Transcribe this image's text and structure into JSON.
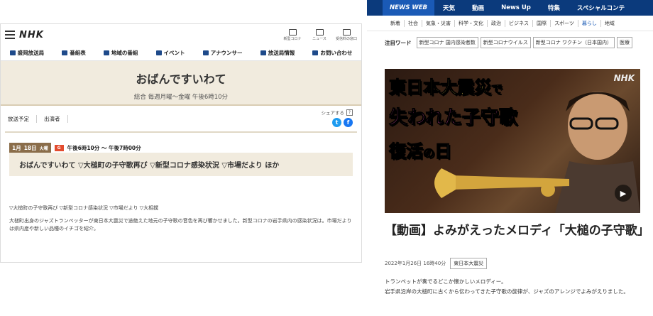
{
  "left": {
    "logo": "NHK",
    "top_icons": [
      {
        "label": "新型コロナ",
        "icon": "corona-icon"
      },
      {
        "label": "ニュース",
        "icon": "news-icon"
      },
      {
        "label": "受信料の窓口",
        "icon": "tv-icon"
      }
    ],
    "nav": [
      "盛岡放送局",
      "番組表",
      "地域の番組",
      "イベント",
      "アナウンサー",
      "放送局情報",
      "お問い合わせ"
    ],
    "program_title": "おばんですいわて",
    "schedule": "総合 毎週月曜～金曜 午後6時10分",
    "tabs": [
      "放送予定",
      "出演者"
    ],
    "share_label": "シェアする",
    "share_help": "?",
    "episode": {
      "month": "1月",
      "day": "18日",
      "weekday": "火曜",
      "channel": "G",
      "time": "午後6時10分 ～ 午後7時00分",
      "title": "おばんですいわて ▽大槌町の子守歌再び ▽新型コロナ感染状況 ▽市場だより ほか",
      "tags": "▽大槌町の子守歌再び ▽新型コロナ感染状況 ▽市場だより ▽大相撲",
      "description": "大槌町出身のジャズトランペッターが東日本大震災で途絶えた地元の子守歌の音色を再び響かせました。新型コロナの岩手県内の感染状況は。市場だよりは県内産や新しい品種のイチゴを紹介。"
    }
  },
  "right": {
    "nav": [
      "NEWS WEB",
      "天気",
      "動画",
      "News Up",
      "特集",
      "スペシャルコンテ"
    ],
    "categories": [
      "新着",
      "社会",
      "気象・災害",
      "科学・文化",
      "政治",
      "ビジネス",
      "国際",
      "スポーツ",
      "暮らし",
      "地域"
    ],
    "trend_label": "注目ワード",
    "trend_tags": [
      "新型コロナ 国内感染者数",
      "新型コロナウイルス",
      "新型コロナ ワクチン（日本国内）",
      "医療"
    ],
    "hero": {
      "line1_a": "東日本大震災",
      "line1_b": "で",
      "line2": "失われた子守歌",
      "line3_a": "復活",
      "line3_b": "の",
      "line3_c": "日",
      "watermark": "NHK"
    },
    "article_title": "【動画】よみがえったメロディ「大槌の子守歌」",
    "date": "2022年1月26日 16時40分",
    "tag": "東日本大震災",
    "body1": "トランペットが奏でるどこか懐かしいメロディー。",
    "body2": "岩手県沿岸の大槌町に古くから伝わってきた子守歌の旋律が、ジャズのアレンジでよみがえりました。"
  }
}
